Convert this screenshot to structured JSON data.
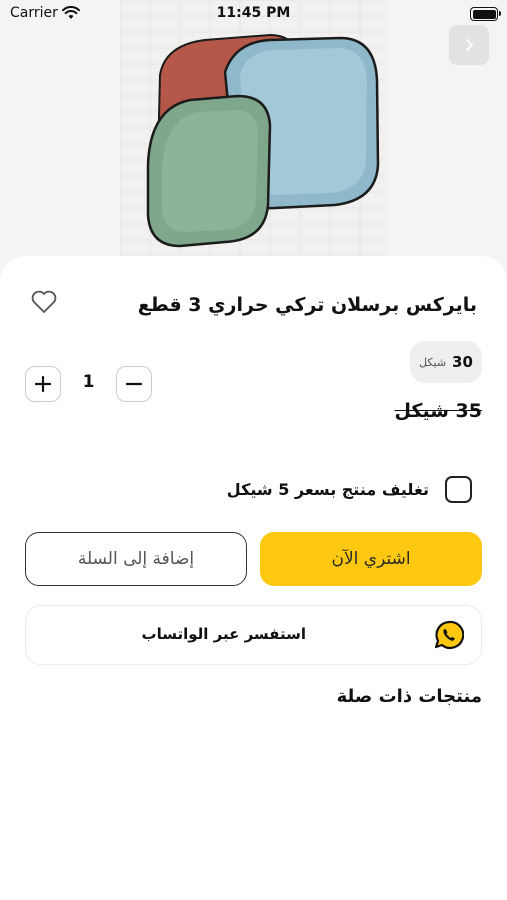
{
  "status_bar": {
    "carrier": "Carrier",
    "time": "11:45 PM"
  },
  "product": {
    "title": "بايركس برسلان تركي حراري 3 قطع",
    "price": "30",
    "currency": "شيكل",
    "old_price": "35 شيكل",
    "quantity": "1"
  },
  "gift_wrap": {
    "label": "تغليف منتج بسعر 5 شيكل",
    "checked": false
  },
  "actions": {
    "buy_now": "اشتري الآن",
    "add_to_cart": "إضافة إلى السلة",
    "whatsapp": "استفسر عبر الواتساب"
  },
  "related": {
    "title": "منتجات ذات صلة"
  },
  "colors": {
    "accent": "#fdc80f",
    "background": "#ffffff",
    "page_bg": "#f4f4f4"
  }
}
